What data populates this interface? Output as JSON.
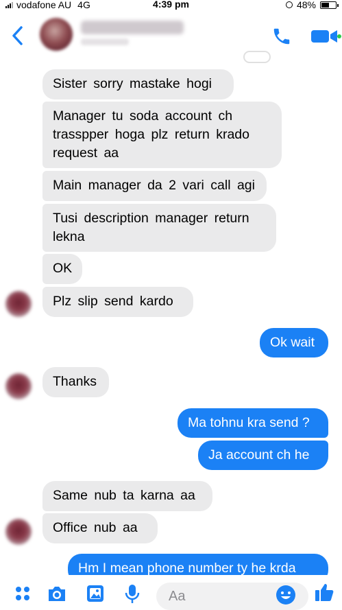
{
  "status_bar": {
    "carrier": "vodafone AU",
    "network": "4G",
    "time": "4:39 pm",
    "battery": "48%"
  },
  "header": {
    "icons": [
      "back-chevron-icon",
      "phone-icon",
      "video-camera-icon"
    ],
    "accent_color": "#1b81f5"
  },
  "messages": [
    {
      "dir": "in",
      "text": "Sister sorry  mastake  hogi"
    },
    {
      "dir": "in",
      "text": "Manager tu  soda  account  ch\ntrasspper  hoga  plz  return  krado\nrequest aa"
    },
    {
      "dir": "in",
      "text": "Main  manager da  2 vari  call  agi"
    },
    {
      "dir": "in",
      "text": "Tusi  description  manager return\nlekna"
    },
    {
      "dir": "in",
      "text": "OK"
    },
    {
      "dir": "in",
      "text": "Plz  slip  send  kardo"
    },
    {
      "dir": "out",
      "text": "Ok wait"
    },
    {
      "dir": "in",
      "text": "Thanks"
    },
    {
      "dir": "out",
      "text": "Ma tohnu kra send ?"
    },
    {
      "dir": "out",
      "text": "Ja account ch he"
    },
    {
      "dir": "in",
      "text": "Same  nub  ta  karna aa"
    },
    {
      "dir": "in",
      "text": "Office  nub  aa"
    },
    {
      "dir": "out",
      "text": "Hm I mean  phone number ty he krda"
    }
  ],
  "composer": {
    "placeholder": "Aa",
    "icons": [
      "apps-grid-icon",
      "camera-icon",
      "image-icon",
      "microphone-icon",
      "emoji-icon",
      "thumbs-up-icon"
    ]
  },
  "colors": {
    "incoming_bubble": "#eaeaeb",
    "outgoing_bubble": "#1b81f5"
  }
}
